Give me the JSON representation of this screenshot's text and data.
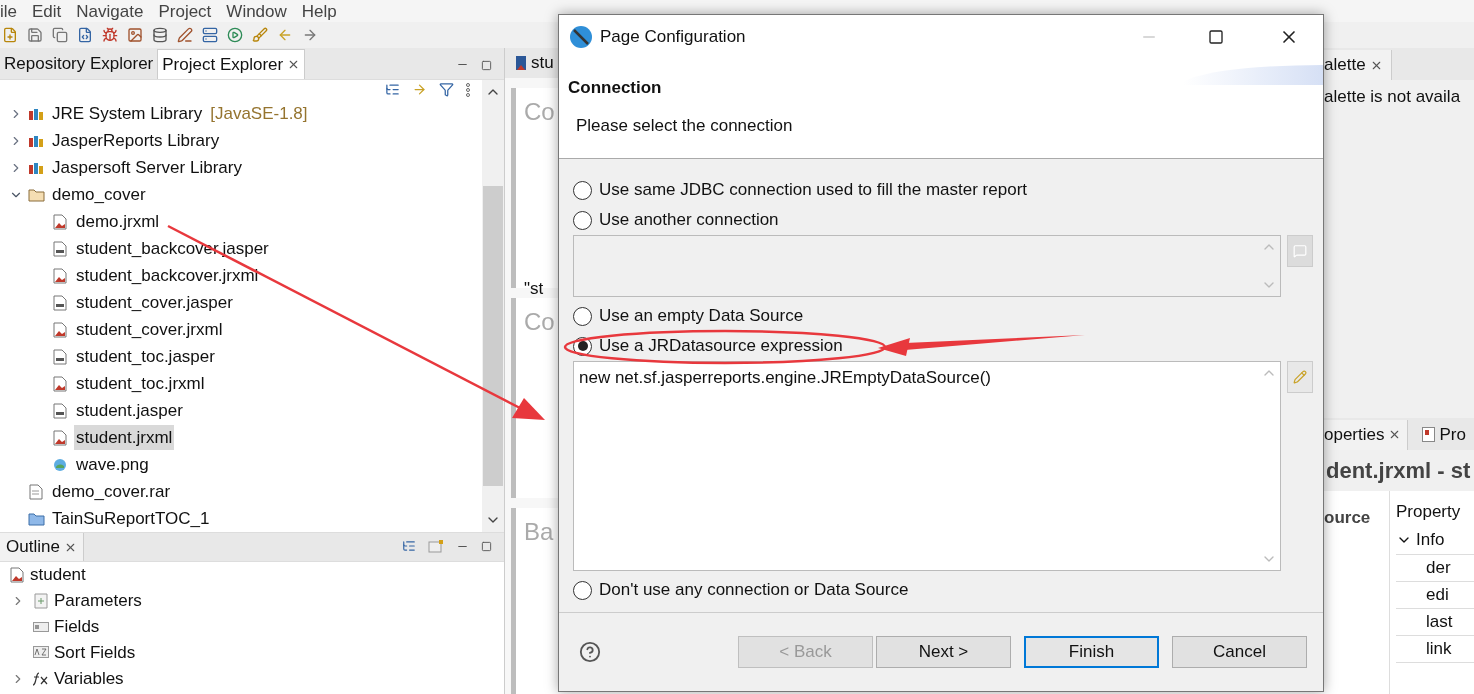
{
  "menu": [
    "ile",
    "Edit",
    "Navigate",
    "Project",
    "Window",
    "Help"
  ],
  "explorer_tabs": [
    {
      "label": "Repository Explorer",
      "selected": false
    },
    {
      "label": "Project Explorer",
      "selected": true
    }
  ],
  "project_tree": [
    {
      "label": "JRE System Library",
      "suffix": "[JavaSE-1.8]",
      "kind": "library",
      "expanded": false,
      "selected": false
    },
    {
      "label": "JasperReports Library",
      "kind": "library",
      "expanded": false,
      "selected": false
    },
    {
      "label": "Jaspersoft Server Library",
      "kind": "library",
      "expanded": false,
      "selected": false
    },
    {
      "label": "demo_cover",
      "kind": "folder",
      "expanded": true,
      "selected": false,
      "children": [
        {
          "label": "demo.jrxml",
          "kind": "jrxml",
          "selected": false
        },
        {
          "label": "student_backcover.jasper",
          "kind": "jasper",
          "selected": false
        },
        {
          "label": "student_backcover.jrxml",
          "kind": "jrxml",
          "selected": false
        },
        {
          "label": "student_cover.jasper",
          "kind": "jasper",
          "selected": false
        },
        {
          "label": "student_cover.jrxml",
          "kind": "jrxml",
          "selected": false
        },
        {
          "label": "student_toc.jasper",
          "kind": "jasper",
          "selected": false
        },
        {
          "label": "student_toc.jrxml",
          "kind": "jrxml",
          "selected": false
        },
        {
          "label": "student.jasper",
          "kind": "jasper",
          "selected": false
        },
        {
          "label": "student.jrxml",
          "kind": "jrxml",
          "selected": true
        },
        {
          "label": "wave.png",
          "kind": "image",
          "selected": false
        }
      ]
    },
    {
      "label": "demo_cover.rar",
      "kind": "archive",
      "selected": false
    },
    {
      "label": "TainSuReportTOC_1",
      "kind": "project",
      "selected": false
    }
  ],
  "outline": {
    "tab": "Outline",
    "root": {
      "label": "student",
      "children": [
        {
          "label": "Parameters",
          "kind": "parameters",
          "expanded": false
        },
        {
          "label": "Fields",
          "kind": "fields"
        },
        {
          "label": "Sort Fields",
          "kind": "sort"
        },
        {
          "label": "Variables",
          "kind": "variables",
          "expanded": false
        }
      ]
    }
  },
  "editor": {
    "tab": "stu",
    "sections": [
      "Co",
      "Co",
      "Ba"
    ],
    "snippet": "\"st"
  },
  "right_panel": {
    "palette_tab": "alette",
    "palette_message": "alette is not availa",
    "tabs": [
      {
        "label": "operties",
        "selected": true
      },
      {
        "label": "Pro",
        "selected": false
      }
    ],
    "title": "dent.jrxml - st",
    "section": "ource",
    "table": {
      "header": "Property",
      "group": {
        "label": "Info",
        "expanded": true,
        "rows": [
          "der",
          "edi",
          "last",
          "link"
        ]
      }
    }
  },
  "dialog": {
    "title": "Page Configuration",
    "heading": "Connection",
    "description": "Please select the connection",
    "options": [
      {
        "label": "Use same JDBC connection used to fill the master report",
        "selected": false
      },
      {
        "label": "Use another connection",
        "selected": false,
        "editor": {
          "disabled": true
        }
      },
      {
        "label": "Use an empty Data Source",
        "selected": false
      },
      {
        "label": "Use a JRDatasource expression",
        "selected": true,
        "editor": {
          "disabled": false,
          "value": "new net.sf.jasperreports.engine.JREmptyDataSource()"
        }
      },
      {
        "label": "Don't use any connection or Data Source",
        "selected": false
      }
    ],
    "buttons": [
      {
        "label": "< Back",
        "disabled": true,
        "default": false
      },
      {
        "label": "Next >",
        "disabled": false,
        "default": false
      },
      {
        "label": "Finish",
        "disabled": false,
        "default": true
      },
      {
        "label": "Cancel",
        "disabled": false,
        "default": false
      }
    ]
  }
}
